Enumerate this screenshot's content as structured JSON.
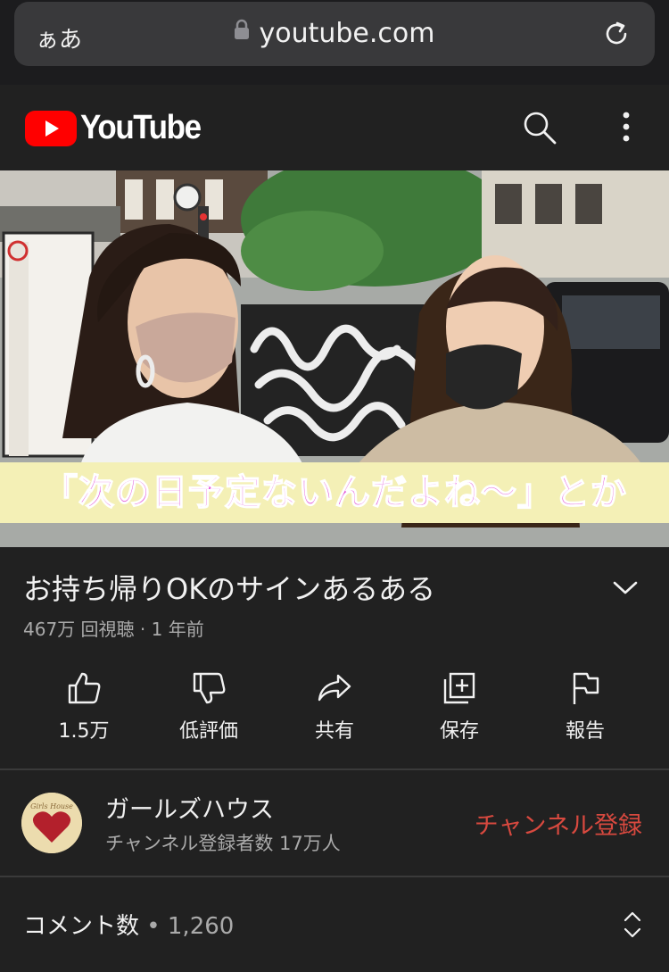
{
  "browser": {
    "text_size_label": "ぁあ",
    "url": "youtube.com"
  },
  "header": {
    "logo_text": "YouTube",
    "icons": [
      "search-icon",
      "more-vert-icon"
    ]
  },
  "video": {
    "caption": "「次の日予定ないんだよね〜」とか"
  },
  "info": {
    "title": "お持ち帰りOKのサインあるある",
    "views": "467万 回視聴",
    "separator": "·",
    "age": "1 年前"
  },
  "actions": [
    {
      "label": "1.5万",
      "icon": "thumb-up-icon"
    },
    {
      "label": "低評価",
      "icon": "thumb-down-icon"
    },
    {
      "label": "共有",
      "icon": "share-icon"
    },
    {
      "label": "保存",
      "icon": "save-playlist-icon"
    },
    {
      "label": "報告",
      "icon": "flag-icon"
    }
  ],
  "channel": {
    "name": "ガールズハウス",
    "subscribers": "チャンネル登録者数 17万人",
    "subscribe_label": "チャンネル登録",
    "avatar_text": "Girls House"
  },
  "comments": {
    "label": "コメント数",
    "separator": " • ",
    "count": "1,260"
  },
  "colors": {
    "background": "#212121",
    "subscribe": "#d8493f",
    "youtube_red": "#ff0000",
    "caption_text": "#e050d8",
    "caption_bg": "#f4f0b6"
  }
}
